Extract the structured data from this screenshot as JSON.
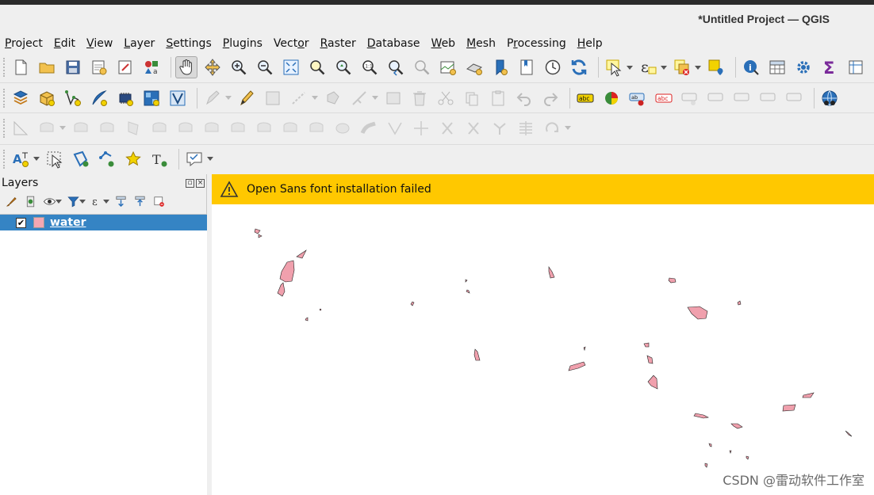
{
  "window": {
    "title": "*Untitled Project — QGIS"
  },
  "menu": [
    "Project",
    "Edit",
    "View",
    "Layer",
    "Settings",
    "Plugins",
    "Vector",
    "Raster",
    "Database",
    "Web",
    "Mesh",
    "Processing",
    "Help"
  ],
  "menu_underline": [
    "P",
    "E",
    "V",
    "L",
    "S",
    "P",
    "o",
    "R",
    "D",
    "W",
    "M",
    "r",
    "H"
  ],
  "layers_panel": {
    "title": "Layers",
    "layers": [
      {
        "name": "water",
        "checked": true,
        "symbol_color": "#f4a7b2"
      }
    ]
  },
  "message_bar": {
    "text": "Open Sans font installation failed",
    "color": "#ffc800"
  },
  "map": {
    "fill": "#f0a0ad",
    "stroke": "#222222"
  },
  "watermark": "CSDN @雷动软件工作室",
  "colors": {
    "selection": "#3584c4",
    "accent_blue": "#2a6fb8"
  }
}
